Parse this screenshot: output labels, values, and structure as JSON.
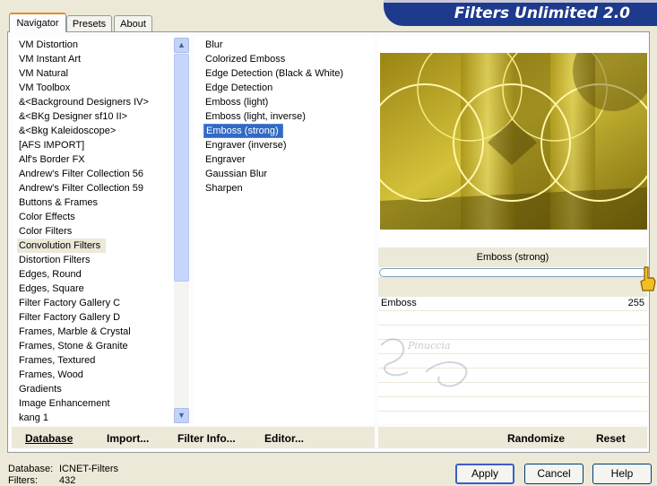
{
  "header": {
    "title": "Filters Unlimited 2.0"
  },
  "tabs": [
    {
      "label": "Navigator",
      "active": true
    },
    {
      "label": "Presets",
      "active": false
    },
    {
      "label": "About",
      "active": false
    }
  ],
  "categories": [
    "VM Distortion",
    "VM Instant Art",
    "VM Natural",
    "VM Toolbox",
    "&<Background Designers IV>",
    "&<BKg Designer sf10 II>",
    "&<Bkg Kaleidoscope>",
    "[AFS IMPORT]",
    "Alf's Border FX",
    "Andrew's Filter Collection 56",
    "Andrew's Filter Collection 59",
    "Buttons & Frames",
    "Color Effects",
    "Color Filters",
    "Convolution Filters",
    "Distortion Filters",
    "Edges, Round",
    "Edges, Square",
    "Filter Factory Gallery C",
    "Filter Factory Gallery D",
    "Frames, Marble & Crystal",
    "Frames, Stone & Granite",
    "Frames, Textured",
    "Frames, Wood",
    "Gradients",
    "Image Enhancement",
    "kang 1"
  ],
  "selected_category": "Convolution Filters",
  "filters": [
    "Blur",
    "Colorized Emboss",
    "Edge Detection (Black & White)",
    "Edge Detection",
    "Emboss (light)",
    "Emboss (light, inverse)",
    "Emboss (strong)",
    "Engraver (inverse)",
    "Engraver",
    "Gaussian Blur",
    "Sharpen"
  ],
  "selected_filter": "Emboss (strong)",
  "left_toolbar": {
    "database": "Database",
    "import": "Import...",
    "filter_info": "Filter Info...",
    "editor": "Editor..."
  },
  "right_toolbar": {
    "randomize": "Randomize",
    "reset": "Reset"
  },
  "filter_panel": {
    "title": "Emboss (strong)",
    "slider_value_fraction": 1.0,
    "params": [
      {
        "name": "Emboss",
        "value": "255"
      }
    ]
  },
  "watermark": {
    "text": "Pinuccia"
  },
  "status": {
    "database_label": "Database:",
    "database_value": "ICNET-Filters",
    "filters_label": "Filters:",
    "filters_value": "432"
  },
  "buttons": {
    "apply": "Apply",
    "cancel": "Cancel",
    "help": "Help"
  },
  "icons": {
    "scroll_up": "chevron-up-icon",
    "scroll_down": "chevron-down-icon",
    "slider_thumb": "pointing-hand-icon"
  },
  "colors": {
    "banner": "#1e3a8c",
    "selection": "#316ac5",
    "active_tab_accent": "#e68b2c"
  }
}
